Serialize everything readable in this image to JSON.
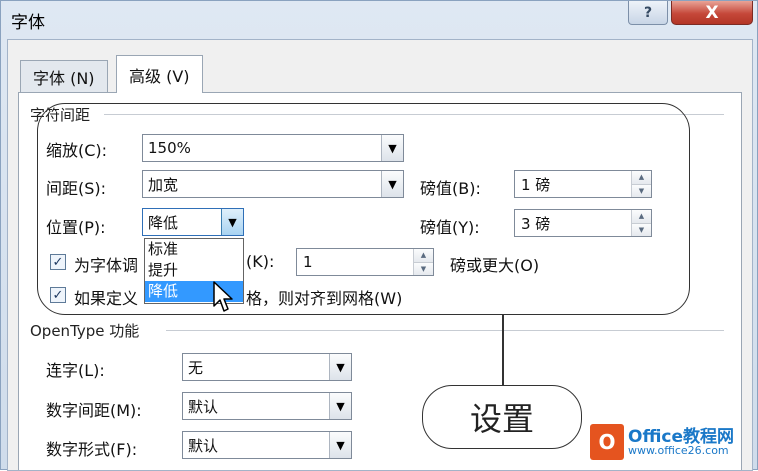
{
  "window": {
    "title": "字体"
  },
  "titlebar": {
    "help_glyph": "?",
    "close_glyph": "X"
  },
  "tabs": [
    {
      "label": "字体 (N)",
      "selected": false
    },
    {
      "label": "高级 (V)",
      "selected": true
    }
  ],
  "character_spacing": {
    "title": "字符间距",
    "scale": {
      "label": "缩放(C):",
      "value": "150%"
    },
    "spacing": {
      "label": "间距(S):",
      "value": "加宽",
      "by_label": "磅值(B):",
      "by_value": "1 磅"
    },
    "position": {
      "label": "位置(P):",
      "value": "降低",
      "by_label": "磅值(Y):",
      "by_value": "3 磅"
    },
    "position_options": [
      "标准",
      "提升",
      "降低"
    ],
    "selected_option": "降低",
    "kerning": {
      "label": "为字体调",
      "suffix": "(K):",
      "value": "1",
      "after": "磅或更大(O)",
      "checked": true
    },
    "snap_grid": {
      "label": "如果定义",
      "suffix": "格，则对齐到网格(W)",
      "checked": true
    }
  },
  "opentype": {
    "title": "OpenType 功能",
    "ligatures": {
      "label": "连字(L):",
      "value": "无"
    },
    "number_spacing": {
      "label": "数字间距(M):",
      "value": "默认"
    },
    "number_forms": {
      "label": "数字形式(F):",
      "value": "默认"
    }
  },
  "annotation": {
    "text": "设置"
  },
  "watermark": {
    "logo_letter": "O",
    "name": "Office教程网",
    "url": "www.office26.com"
  },
  "colors": {
    "accent": "#3399ff",
    "close": "#c5483a",
    "logo": "#e5541f"
  }
}
